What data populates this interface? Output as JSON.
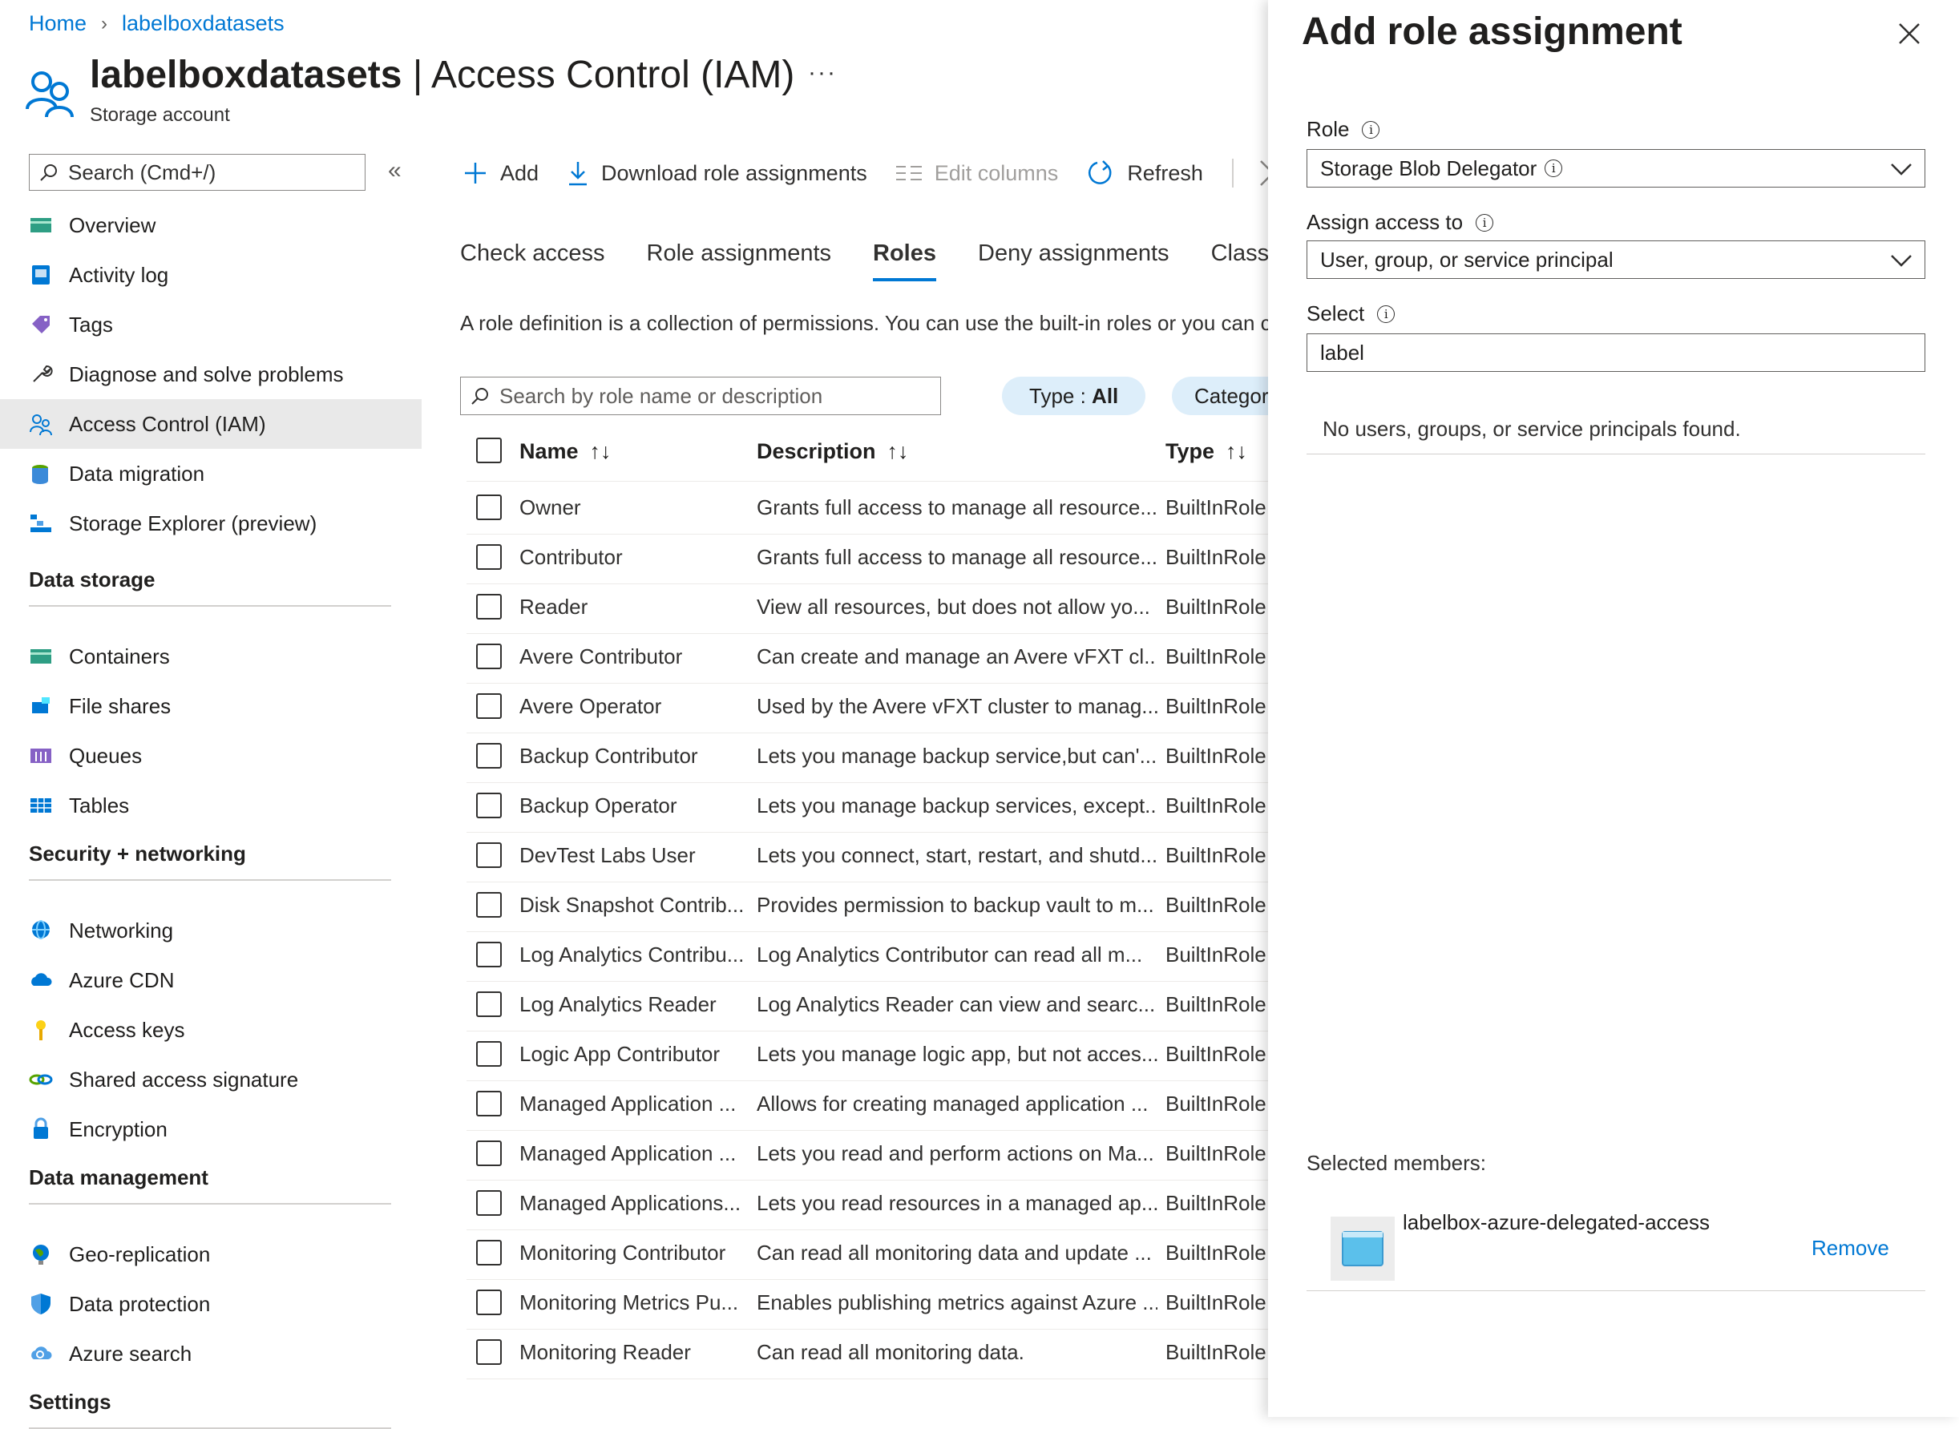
{
  "breadcrumb": {
    "home": "Home",
    "current": "labelboxdatasets"
  },
  "header": {
    "title_bold": "labelboxdatasets",
    "title_rest": " | Access Control (IAM)",
    "subtitle": "Storage account",
    "more": "···"
  },
  "sidebar": {
    "search_placeholder": "Search (Cmd+/)",
    "collapse": "«",
    "items": [
      {
        "label": "Overview",
        "icon": "overview-icon"
      },
      {
        "label": "Activity log",
        "icon": "activity-log-icon"
      },
      {
        "label": "Tags",
        "icon": "tag-icon"
      },
      {
        "label": "Diagnose and solve problems",
        "icon": "wrench-icon"
      },
      {
        "label": "Access Control (IAM)",
        "icon": "people-icon",
        "active": true
      },
      {
        "label": "Data migration",
        "icon": "data-migration-icon"
      },
      {
        "label": "Storage Explorer (preview)",
        "icon": "storage-explorer-icon"
      }
    ],
    "groups": [
      {
        "title": "Data storage",
        "items": [
          {
            "label": "Containers",
            "icon": "containers-icon"
          },
          {
            "label": "File shares",
            "icon": "file-shares-icon"
          },
          {
            "label": "Queues",
            "icon": "queues-icon"
          },
          {
            "label": "Tables",
            "icon": "tables-icon"
          }
        ]
      },
      {
        "title": "Security + networking",
        "items": [
          {
            "label": "Networking",
            "icon": "networking-icon"
          },
          {
            "label": "Azure CDN",
            "icon": "cloud-icon"
          },
          {
            "label": "Access keys",
            "icon": "key-icon"
          },
          {
            "label": "Shared access signature",
            "icon": "link-icon"
          },
          {
            "label": "Encryption",
            "icon": "lock-icon"
          }
        ]
      },
      {
        "title": "Data management",
        "items": [
          {
            "label": "Geo-replication",
            "icon": "globe-icon"
          },
          {
            "label": "Data protection",
            "icon": "shield-icon"
          },
          {
            "label": "Azure search",
            "icon": "cloud-search-icon"
          }
        ]
      },
      {
        "title": "Settings",
        "items": []
      }
    ]
  },
  "toolbar": {
    "add": "Add",
    "download": "Download role assignments",
    "edit_columns": "Edit columns",
    "refresh": "Refresh"
  },
  "tabs": [
    "Check access",
    "Role assignments",
    "Roles",
    "Deny assignments",
    "Classic adr"
  ],
  "active_tab": "Roles",
  "description": "A role definition is a collection of permissions. You can use the built-in roles or you can c",
  "role_search_placeholder": "Search by role name or description",
  "filters": {
    "type_label": "Type : ",
    "type_value": "All",
    "category_label": "Category :"
  },
  "table": {
    "columns": [
      "Name",
      "Description",
      "Type"
    ],
    "rows": [
      {
        "name": "Owner",
        "description": "Grants full access to manage all resource...",
        "type": "BuiltInRole"
      },
      {
        "name": "Contributor",
        "description": "Grants full access to manage all resource...",
        "type": "BuiltInRole"
      },
      {
        "name": "Reader",
        "description": "View all resources, but does not allow yo...",
        "type": "BuiltInRole"
      },
      {
        "name": "Avere Contributor",
        "description": "Can create and manage an Avere vFXT cl...",
        "type": "BuiltInRole"
      },
      {
        "name": "Avere Operator",
        "description": "Used by the Avere vFXT cluster to manag...",
        "type": "BuiltInRole"
      },
      {
        "name": "Backup Contributor",
        "description": "Lets you manage backup service,but can'...",
        "type": "BuiltInRole"
      },
      {
        "name": "Backup Operator",
        "description": "Lets you manage backup services, except...",
        "type": "BuiltInRole"
      },
      {
        "name": "DevTest Labs User",
        "description": "Lets you connect, start, restart, and shutd...",
        "type": "BuiltInRole"
      },
      {
        "name": "Disk Snapshot Contrib...",
        "description": "Provides permission to backup vault to m...",
        "type": "BuiltInRole"
      },
      {
        "name": "Log Analytics Contribu...",
        "description": "Log Analytics Contributor can read all m...",
        "type": "BuiltInRole"
      },
      {
        "name": "Log Analytics Reader",
        "description": "Log Analytics Reader can view and searc...",
        "type": "BuiltInRole"
      },
      {
        "name": "Logic App Contributor",
        "description": "Lets you manage logic app, but not acces...",
        "type": "BuiltInRole"
      },
      {
        "name": "Managed Application ...",
        "description": "Allows for creating managed application ...",
        "type": "BuiltInRole"
      },
      {
        "name": "Managed Application ...",
        "description": "Lets you read and perform actions on Ma...",
        "type": "BuiltInRole"
      },
      {
        "name": "Managed Applications...",
        "description": "Lets you read resources in a managed ap...",
        "type": "BuiltInRole"
      },
      {
        "name": "Monitoring Contributor",
        "description": "Can read all monitoring data and update ...",
        "type": "BuiltInRole"
      },
      {
        "name": "Monitoring Metrics Pu...",
        "description": "Enables publishing metrics against Azure ...",
        "type": "BuiltInRole"
      },
      {
        "name": "Monitoring Reader",
        "description": "Can read all monitoring data.",
        "type": "BuiltInRole"
      }
    ]
  },
  "panel": {
    "title": "Add role assignment",
    "role_label": "Role",
    "role_value": "Storage Blob Delegator",
    "assign_label": "Assign access to",
    "assign_value": "User, group, or service principal",
    "select_label": "Select",
    "select_value": "label",
    "no_results": "No users, groups, or service principals found.",
    "selected_members_label": "Selected members:",
    "member_name": "labelbox-azure-delegated-access",
    "remove": "Remove"
  },
  "colors": {
    "accent": "#0078d4",
    "pill": "#ddeefa",
    "active_nav": "#e9e9e9"
  }
}
